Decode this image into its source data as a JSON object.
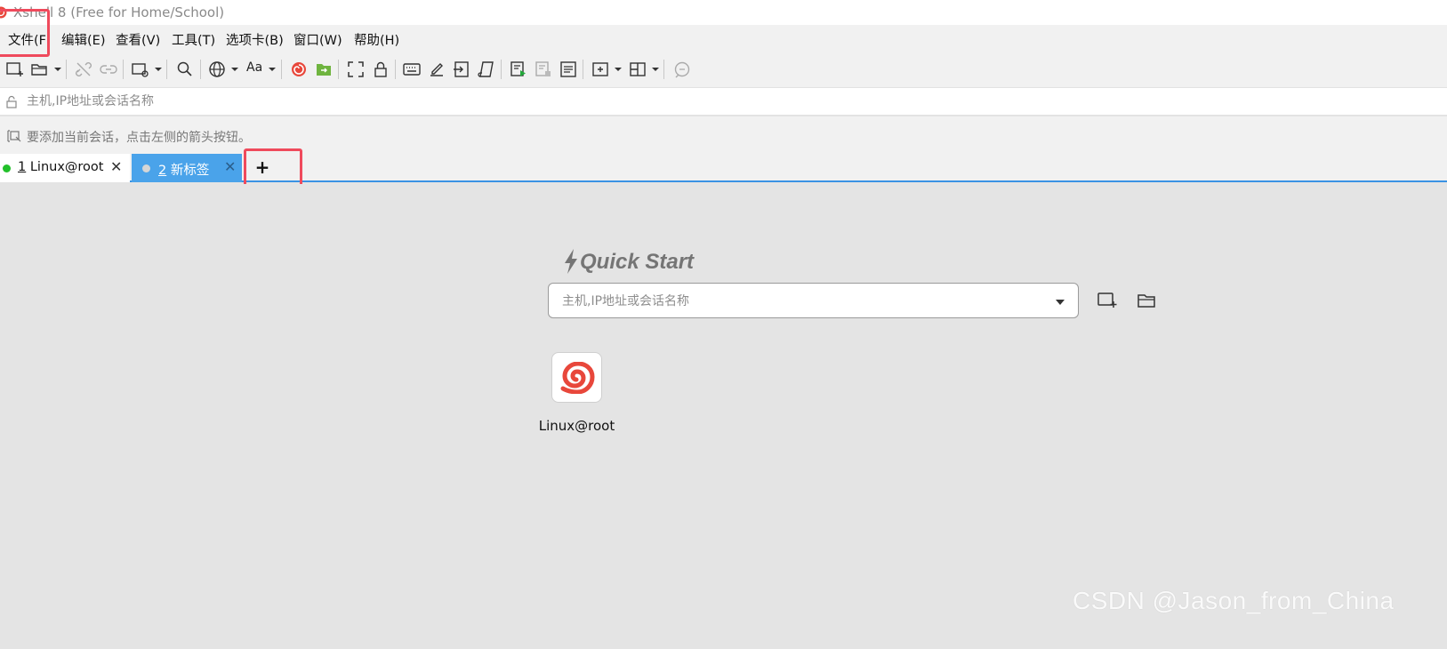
{
  "window": {
    "title": "Xshell 8 (Free for Home/School)"
  },
  "menu": [
    {
      "label": "文件(F"
    },
    {
      "label": "编辑(E)"
    },
    {
      "label": "查看(V)"
    },
    {
      "label": "工具(T)"
    },
    {
      "label": "选项卡(B)"
    },
    {
      "label": "窗口(W)"
    },
    {
      "label": "帮助(H)"
    }
  ],
  "toolbar": {
    "font_label": "Aa"
  },
  "addressbar": {
    "placeholder": "主机,IP地址或会话名称",
    "value": ""
  },
  "hint": {
    "text": "要添加当前会话，点击左侧的箭头按钮。"
  },
  "tabs": [
    {
      "number": "1",
      "label": "Linux@root",
      "status": "connected",
      "status_color": "#22c02a",
      "active": false
    },
    {
      "number": "2",
      "label": "新标签",
      "status": "disconnected",
      "status_color": "#d6d6d6",
      "active": true
    }
  ],
  "tab_add_label": "+",
  "quick_start": {
    "title": "Quick Start",
    "placeholder": "主机,IP地址或会话名称",
    "sessions": [
      {
        "label": "Linux@root"
      }
    ]
  },
  "watermark": "CSDN @Jason_from_China",
  "colors": {
    "highlight_box": "#ef4a5c",
    "tab_active_bg": "#4aa3ea",
    "tab_underline": "#3a92e4",
    "xshell_red": "#e8473b",
    "xftp_green": "#6fb43f"
  }
}
